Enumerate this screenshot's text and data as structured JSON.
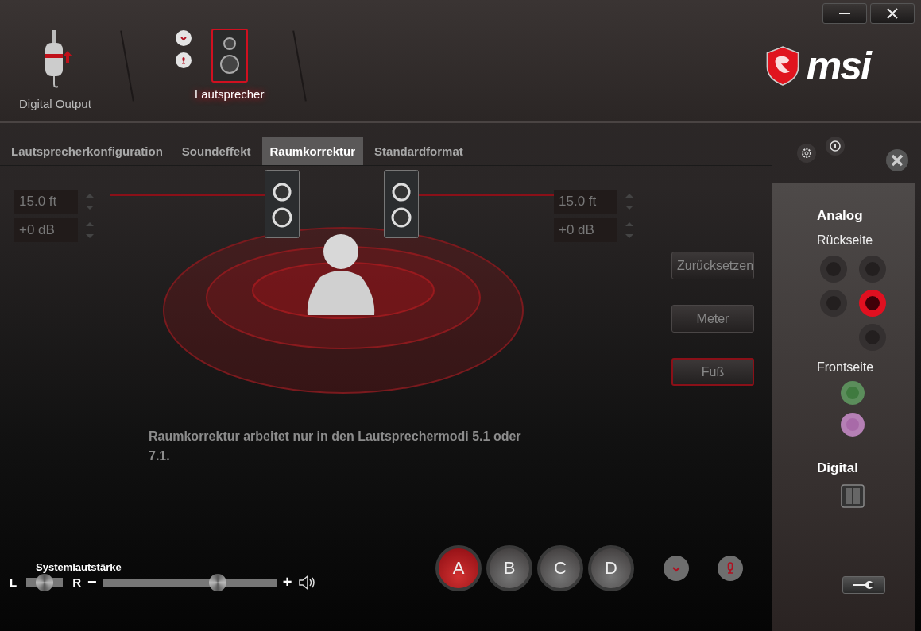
{
  "devices": [
    {
      "label": "Digital Output",
      "kind": "digital",
      "selected": false
    },
    {
      "label": "Lautsprecher",
      "kind": "speaker",
      "selected": true
    }
  ],
  "logo": "msi",
  "tabs": [
    {
      "label": "Lautsprecherkonfiguration",
      "selected": false
    },
    {
      "label": "Soundeffekt",
      "selected": false
    },
    {
      "label": "Raumkorrektur",
      "selected": true
    },
    {
      "label": "Standardformat",
      "selected": false
    }
  ],
  "room": {
    "left": {
      "distance": "15.0 ft",
      "gain": "+0 dB"
    },
    "right": {
      "distance": "15.0 ft",
      "gain": "+0 dB"
    }
  },
  "unit_buttons": [
    {
      "label": "Zurücksetzen",
      "selected": false
    },
    {
      "label": "Meter",
      "selected": false
    },
    {
      "label": "Fuß",
      "selected": true
    }
  ],
  "note": "Raumkorrektur arbeitet nur in den Lautsprechermodi 5.1 oder 7.1.",
  "volume": {
    "title": "Systemlautstärke",
    "left": "L",
    "right": "R",
    "minus": "−",
    "plus": "+",
    "balance": {
      "level": 0.5
    },
    "master": {
      "level": 0.66
    }
  },
  "presets": [
    {
      "label": "A",
      "selected": true
    },
    {
      "label": "B",
      "selected": false
    },
    {
      "label": "C",
      "selected": false
    },
    {
      "label": "D",
      "selected": false
    }
  ],
  "side_panel": {
    "analog_title": "Analog",
    "rear_title": "Rückseite",
    "rear_jacks": [
      {
        "active": false
      },
      {
        "active": false
      },
      {
        "active": false
      },
      {
        "active": true
      },
      {
        "active": false
      }
    ],
    "front_title": "Frontseite",
    "front_jacks": [
      {
        "color": "#3f7a3f"
      },
      {
        "color": "#a86aa8"
      }
    ],
    "digital_title": "Digital"
  }
}
